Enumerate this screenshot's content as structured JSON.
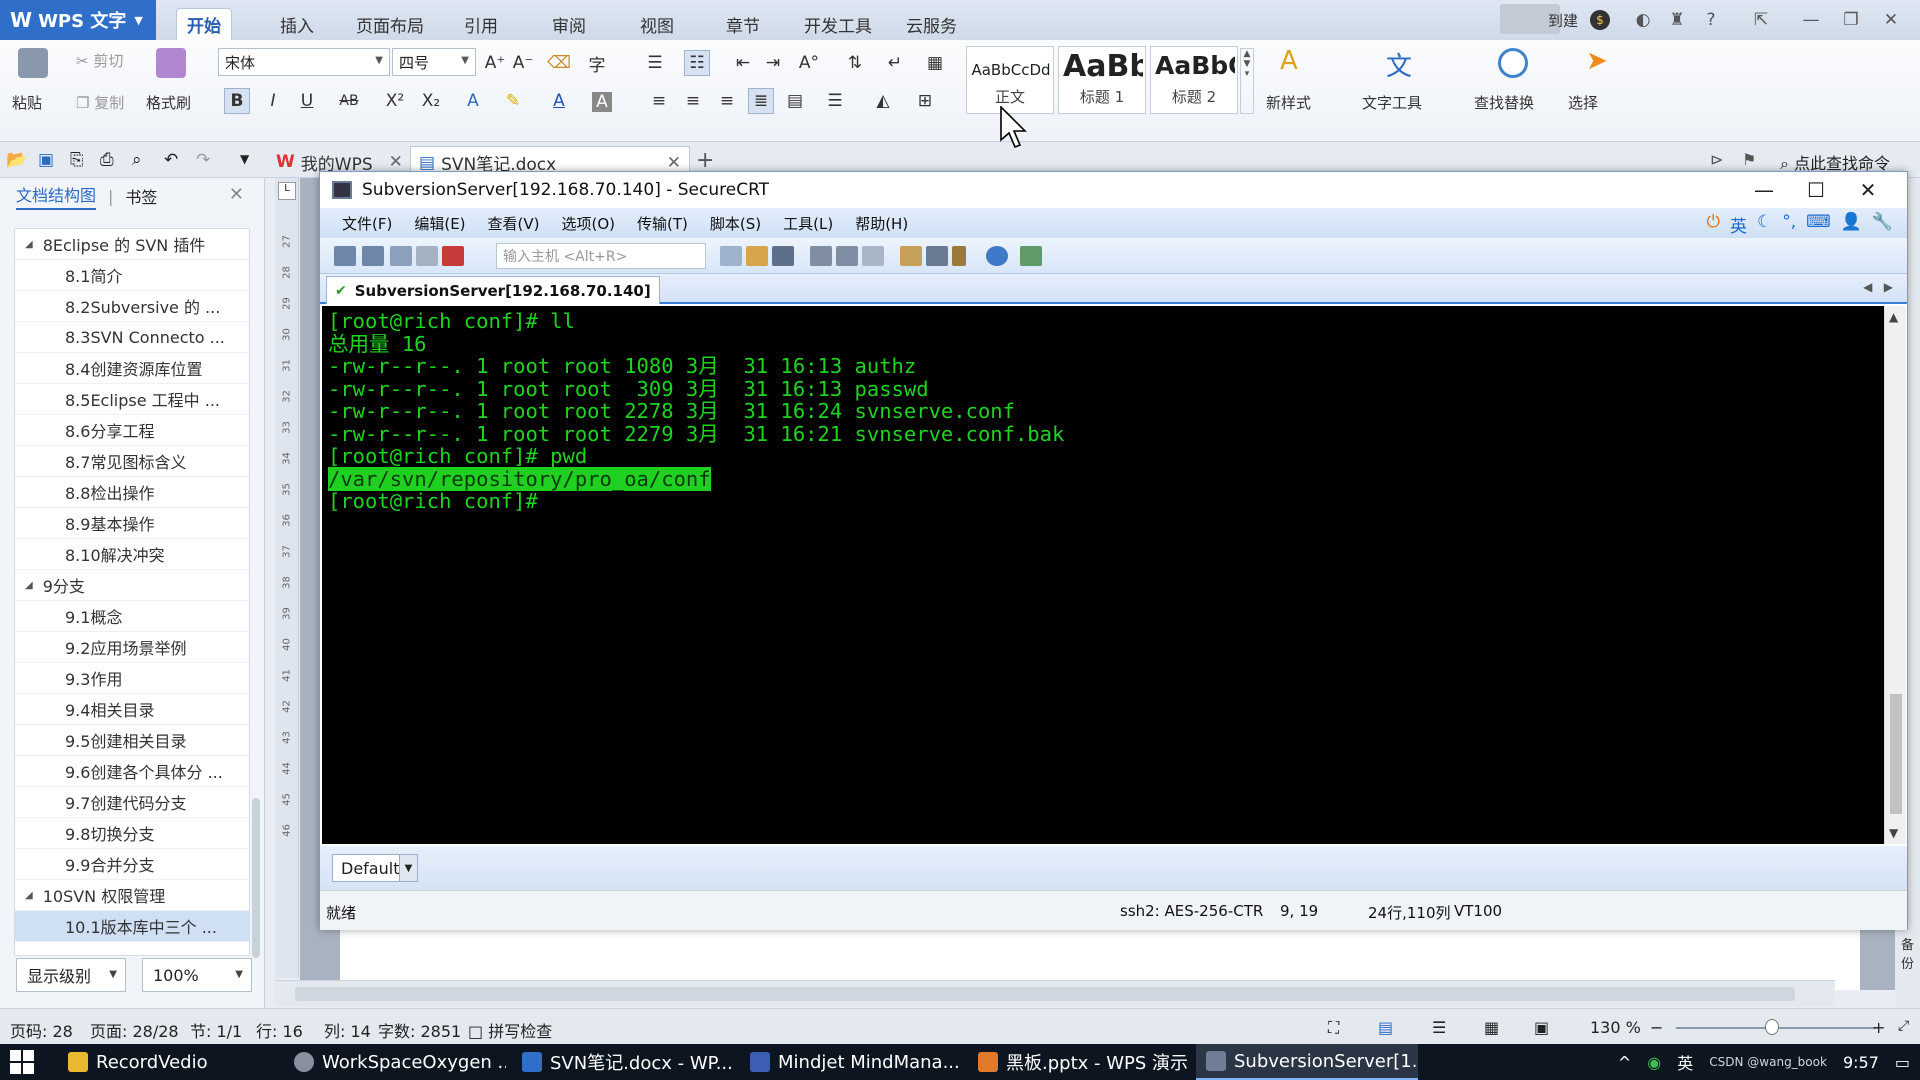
{
  "wps": {
    "app_title": "WPS 文字",
    "tabs": [
      "开始",
      "插入",
      "页面布局",
      "引用",
      "审阅",
      "视图",
      "章节",
      "开发工具",
      "云服务"
    ],
    "title_right_text": "到建",
    "ribbon": {
      "paste": "粘贴",
      "cut": "剪切",
      "copy": "复制",
      "format_painter": "格式刷",
      "font_name": "宋体",
      "font_size": "四号",
      "styles": [
        {
          "sample": "AaBbCcDd",
          "name": "正文"
        },
        {
          "sample": "AaBb",
          "name": "标题 1"
        },
        {
          "sample": "AaBbC",
          "name": "标题 2"
        }
      ],
      "new_style": "新样式",
      "text_tools": "文字工具",
      "find_replace": "查找替换",
      "select": "选择"
    },
    "doc_tabs": [
      {
        "label": "我的WPS"
      },
      {
        "label": "SVN笔记.docx"
      }
    ],
    "search_cmd": "点此查找命令",
    "left_pane": {
      "tab_outline": "文档结构图",
      "tab_bookmark": "书签",
      "items": [
        {
          "label": "8Eclipse 的 SVN 插件",
          "level": 1
        },
        {
          "label": "8.1简介",
          "level": 2
        },
        {
          "label": "8.2Subversive 的 ...",
          "level": 2
        },
        {
          "label": "8.3SVN Connecto ...",
          "level": 2
        },
        {
          "label": "8.4创建资源库位置",
          "level": 2
        },
        {
          "label": "8.5Eclipse 工程中 ...",
          "level": 2
        },
        {
          "label": "8.6分享工程",
          "level": 2
        },
        {
          "label": "8.7常见图标含义",
          "level": 2
        },
        {
          "label": "8.8检出操作",
          "level": 2
        },
        {
          "label": "8.9基本操作",
          "level": 2
        },
        {
          "label": "8.10解决冲突",
          "level": 2
        },
        {
          "label": "9分支",
          "level": 1
        },
        {
          "label": "9.1概念",
          "level": 2
        },
        {
          "label": "9.2应用场景举例",
          "level": 2
        },
        {
          "label": "9.3作用",
          "level": 2
        },
        {
          "label": "9.4相关目录",
          "level": 2
        },
        {
          "label": "9.5创建相关目录",
          "level": 2
        },
        {
          "label": "9.6创建各个具体分 ...",
          "level": 2
        },
        {
          "label": "9.7创建代码分支",
          "level": 2
        },
        {
          "label": "9.8切换分支",
          "level": 2
        },
        {
          "label": "9.9合并分支",
          "level": 2
        },
        {
          "label": "10SVN 权限管理",
          "level": 1
        },
        {
          "label": "10.1版本库中三个 ...",
          "level": 2
        }
      ],
      "show_level": "显示级别",
      "zoom": "100%"
    },
    "ruler_numbers": [
      "27",
      "28",
      "29",
      "30",
      "31",
      "32",
      "33",
      "34",
      "35",
      "36",
      "37",
      "38",
      "39",
      "40",
      "41",
      "42",
      "43",
      "44",
      "45",
      "46"
    ],
    "right_strip_label": "备份",
    "status": {
      "page_no": "页码: 28",
      "pages": "页面: 28/28",
      "section": "节: 1/1",
      "row": "行: 16",
      "col": "列: 14",
      "words": "字数: 2851",
      "spell": "拼写检查",
      "zoom": "130 %"
    }
  },
  "crt": {
    "title": "SubversionServer[192.168.70.140] - SecureCRT",
    "menu": [
      "文件(F)",
      "编辑(E)",
      "查看(V)",
      "选项(O)",
      "传输(T)",
      "脚本(S)",
      "工具(L)",
      "帮助(H)"
    ],
    "ime_label": "英",
    "host_placeholder": "输入主机 <Alt+R>",
    "session_tab": "SubversionServer[192.168.70.140]",
    "terminal_lines": [
      "[root@rich conf]# ll",
      "总用量 16",
      "-rw-r--r--. 1 root root 1080 3月  31 16:13 authz",
      "-rw-r--r--. 1 root root  309 3月  31 16:13 passwd",
      "-rw-r--r--. 1 root root 2278 3月  31 16:24 svnserve.conf",
      "-rw-r--r--. 1 root root 2279 3月  31 16:21 svnserve.conf.bak",
      "[root@rich conf]# pwd"
    ],
    "terminal_highlight": "/var/svn/repository/pro_oa/conf",
    "terminal_prompt": "[root@rich conf]# ",
    "cmd_default": "Default",
    "status": {
      "ready": "就绪",
      "cipher": "ssh2: AES-256-CTR",
      "cursor": "9,  19",
      "size": "24行,110列",
      "term": "VT100"
    }
  },
  "taskbar": {
    "items": [
      {
        "label": "RecordVedio",
        "color": "#e8b930"
      },
      {
        "label": "WorkSpaceOxygen ...",
        "color": "#8a8fa0"
      },
      {
        "label": "SVN笔记.docx - WP...",
        "color": "#2f6fc9"
      },
      {
        "label": "Mindjet MindMana...",
        "color": "#3c5fb5"
      },
      {
        "label": "黑板.pptx - WPS 演示",
        "color": "#e07a2a"
      },
      {
        "label": "SubversionServer[1...",
        "color": "#6f7d95"
      }
    ],
    "ime": "英",
    "clock": "9:57",
    "watermark": "CSDN @wang_book"
  }
}
